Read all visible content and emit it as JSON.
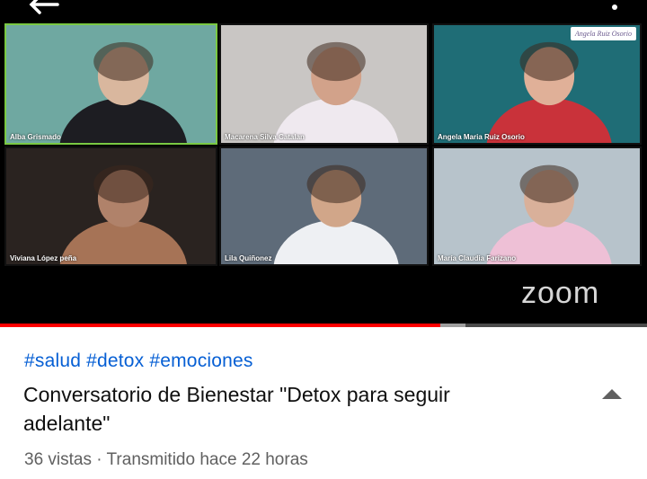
{
  "video": {
    "participants": [
      {
        "name": "Alba Grismado",
        "active": true,
        "bg": "#6fa8a1",
        "skin": "#d9b79e",
        "shirt": "#1d1d22"
      },
      {
        "name": "Macarena Silva Catalan",
        "active": false,
        "bg": "#c9c6c4",
        "skin": "#d2a28a",
        "shirt": "#efe9ef"
      },
      {
        "name": "Angela Maria Ruiz Osorio",
        "active": false,
        "bg": "#1f6d76",
        "skin": "#e0b098",
        "shirt": "#c9323a"
      },
      {
        "name": "Viviana López peña",
        "active": false,
        "bg": "#2a2320",
        "skin": "#b0826a",
        "shirt": "#a67356"
      },
      {
        "name": "Lila Quiñonez",
        "active": false,
        "bg": "#5e6b79",
        "skin": "#d1a689",
        "shirt": "#eef0f3"
      },
      {
        "name": "María Claudia Farizano",
        "active": false,
        "bg": "#b7c3cb",
        "skin": "#d9b09a",
        "shirt": "#eec0d6"
      }
    ],
    "watermark_text": "Angela Ruiz Osorio",
    "zoom_logo": "zoom",
    "progress_fraction": 0.68,
    "buffer_fraction": 0.72
  },
  "info": {
    "hashtags": [
      "#salud",
      "#detox",
      "#emociones"
    ],
    "title": "Conversatorio de Bienestar \"Detox para seguir adelante\"",
    "meta": "36 vistas · Transmitido hace 22 horas"
  },
  "colors": {
    "hashtag": "#065fd4",
    "progress": "#ff0000",
    "active_speaker": "#7ac943"
  },
  "icons": {
    "back": "arrow-left-icon",
    "more": "more-vertical-icon",
    "collapse": "chevron-up-icon"
  }
}
